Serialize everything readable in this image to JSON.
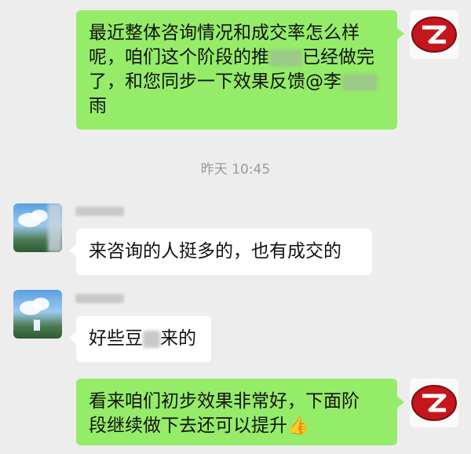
{
  "messages": [
    {
      "id": "m1",
      "side": "right",
      "text_parts": [
        "最近整体咨询情况和成交率怎么样",
        "呢，咱们这个阶段的推",
        "已经做完",
        "了，和您同步一下效果反馈@李",
        "雨"
      ]
    },
    {
      "id": "m2",
      "side": "left",
      "text": "来咨询的人挺多的，也有成交的"
    },
    {
      "id": "m3",
      "side": "left",
      "text_parts": [
        "好些豆",
        "来的"
      ]
    },
    {
      "id": "m4",
      "side": "right",
      "text_parts": [
        "看来咱们初步效果非常好，下面阶",
        "段继续做下去还可以提升"
      ]
    }
  ],
  "timestamp": "昨天 10:45",
  "icons": {
    "logo": "red-z-logo-icon",
    "thumbs": "thumbs-up-emoji"
  },
  "colors": {
    "chat_bg": "#ededed",
    "self_bubble": "#95ec69",
    "other_bubble": "#ffffff",
    "logo_red": "#c4161c"
  }
}
